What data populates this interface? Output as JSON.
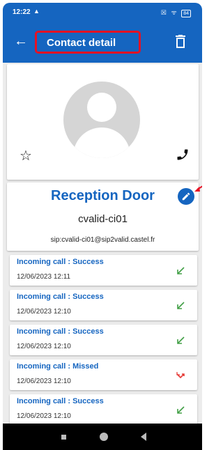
{
  "status_bar": {
    "time": "12:22",
    "warning_glyph": "▲",
    "right_icons": "☒ ᯤ",
    "battery": "84"
  },
  "app_bar": {
    "title": "Contact detail",
    "back_glyph": "←"
  },
  "actions": {
    "star_glyph": "☆"
  },
  "contact": {
    "name": "Reception Door",
    "user": "cvalid-ci01",
    "sip": "sip:cvalid-ci01@sip2valid.castel.fr"
  },
  "call_history": [
    {
      "title": "Incoming call : Success",
      "time": "12/06/2023 12:11",
      "status": "success"
    },
    {
      "title": "Incoming call : Success",
      "time": "12/06/2023 12:10",
      "status": "success"
    },
    {
      "title": "Incoming call : Success",
      "time": "12/06/2023 12:10",
      "status": "success"
    },
    {
      "title": "Incoming call : Missed",
      "time": "12/06/2023 12:10",
      "status": "missed"
    },
    {
      "title": "Incoming call : Success",
      "time": "12/06/2023 12:10",
      "status": "success"
    }
  ],
  "colors": {
    "primary": "#1565c0",
    "success": "#43a047",
    "missed": "#e53935",
    "highlight": "#e81123"
  },
  "icons": {
    "back": "arrow-left-icon",
    "delete": "trash-icon",
    "favorite": "star-outline-icon",
    "call": "phone-icon",
    "edit": "pencil-icon",
    "success": "arrow-down-left-icon",
    "missed": "missed-call-icon"
  }
}
